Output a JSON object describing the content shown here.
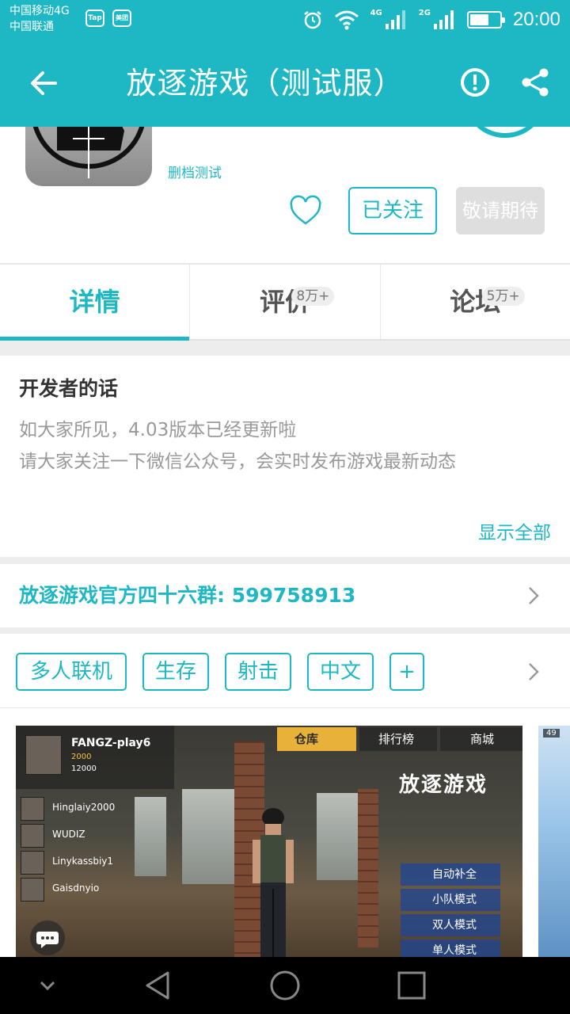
{
  "status_bar": {
    "carrier_1": "中国移动4G",
    "carrier_2": "中国联通",
    "app_badge_1": "Tap",
    "app_badge_2": "美团",
    "net_1": "4G",
    "net_2": "2G",
    "battery_level": 0.65,
    "time": "20:00"
  },
  "toolbar": {
    "title": "放逐游戏（测试服）",
    "back_icon": "arrow-left-icon",
    "report_icon": "exclamation-circle-icon",
    "share_icon": "share-icon"
  },
  "game": {
    "tag_line": "删档测试",
    "follow_label": "已关注",
    "await_label": "敬请期待"
  },
  "tabs": [
    {
      "label": "详情",
      "count": ""
    },
    {
      "label": "评价",
      "count": "8万+"
    },
    {
      "label": "论坛",
      "count": "5万+"
    }
  ],
  "developer": {
    "heading": "开发者的话",
    "line_1": "如大家所见，4.03版本已经更新啦",
    "line_2": "请大家关注一下微信公众号，会实时发布游戏最新动态",
    "show_all": "显示全部"
  },
  "qq_group": {
    "text": "放逐游戏官方四十六群:  599758913"
  },
  "tags": [
    "多人联机",
    "生存",
    "射击",
    "中文",
    "+"
  ],
  "screenshot": {
    "player_name": "FANGZ-play6",
    "coins": "2000",
    "gems": "12000",
    "friends": [
      "Hinglaiy2000",
      "WUDIZ",
      "Linykassbiy1",
      "Gaisdnyio"
    ],
    "menu": [
      "仓库",
      "排行榜",
      "商城"
    ],
    "logo": "放逐游戏",
    "modes": [
      "自动补全",
      "小队模式",
      "双人模式",
      "单人模式"
    ],
    "next_badge": "49"
  },
  "colors": {
    "accent": "#1eb8c4",
    "disabled": "#dedede"
  }
}
